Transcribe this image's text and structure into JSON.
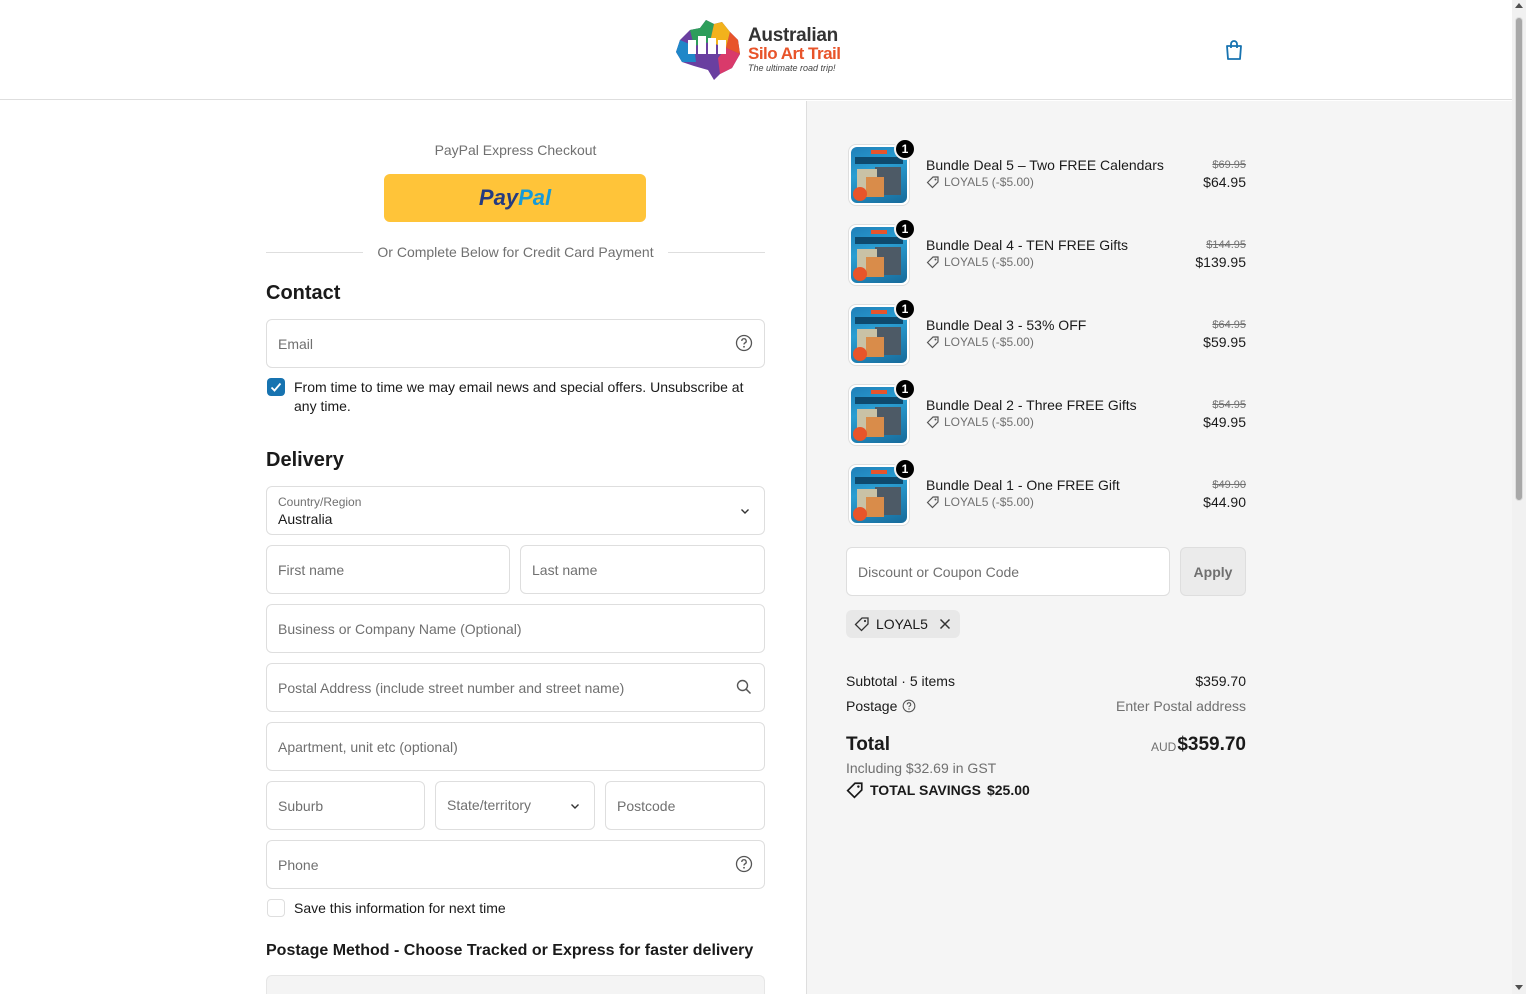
{
  "header": {
    "logo_line1": "Australian",
    "logo_line2": "Silo Art Trail",
    "logo_tagline": "The ultimate road trip!"
  },
  "express": {
    "title": "PayPal Express Checkout",
    "paypal_part1": "Pay",
    "paypal_part2": "Pal",
    "divider_text": "Or Complete Below for Credit Card Payment"
  },
  "contact": {
    "title": "Contact",
    "email_placeholder": "Email",
    "newsletter_text": "From time to time we may email news and special offers. Unsubscribe at any time.",
    "newsletter_checked": true
  },
  "delivery": {
    "title": "Delivery",
    "country_label": "Country/Region",
    "country_value": "Australia",
    "first_name_placeholder": "First name",
    "last_name_placeholder": "Last name",
    "company_placeholder": "Business or Company Name (Optional)",
    "address_placeholder": "Postal Address (include street number and street name)",
    "apartment_placeholder": "Apartment, unit etc (optional)",
    "suburb_placeholder": "Suburb",
    "state_placeholder": "State/territory",
    "postcode_placeholder": "Postcode",
    "phone_placeholder": "Phone",
    "save_info_text": "Save this information for next time",
    "save_info_checked": false
  },
  "postage": {
    "title": "Postage Method - Choose Tracked or Express for faster delivery"
  },
  "cart": {
    "items": [
      {
        "name": "Bundle Deal 5 – Two FREE Calendars",
        "discount": "LOYAL5 (-$5.00)",
        "old_price": "$69.95",
        "price": "$64.95",
        "qty": "1"
      },
      {
        "name": "Bundle Deal 4 - TEN FREE Gifts",
        "discount": "LOYAL5 (-$5.00)",
        "old_price": "$144.95",
        "price": "$139.95",
        "qty": "1"
      },
      {
        "name": "Bundle Deal 3 - 53% OFF",
        "discount": "LOYAL5 (-$5.00)",
        "old_price": "$64.95",
        "price": "$59.95",
        "qty": "1"
      },
      {
        "name": "Bundle Deal 2 - Three FREE Gifts",
        "discount": "LOYAL5 (-$5.00)",
        "old_price": "$54.95",
        "price": "$49.95",
        "qty": "1"
      },
      {
        "name": "Bundle Deal 1 - One FREE Gift",
        "discount": "LOYAL5 (-$5.00)",
        "old_price": "$49.90",
        "price": "$44.90",
        "qty": "1"
      }
    ],
    "coupon_placeholder": "Discount or Coupon Code",
    "apply_label": "Apply",
    "applied_code": "LOYAL5"
  },
  "summary": {
    "subtotal_label": "Subtotal · 5 items",
    "subtotal_value": "$359.70",
    "postage_label": "Postage",
    "postage_value": "Enter Postal address",
    "total_label": "Total",
    "currency": "AUD",
    "total_value": "$359.70",
    "gst_text": "Including $32.69 in GST",
    "savings_label": "TOTAL SAVINGS",
    "savings_value": "$25.00"
  },
  "colors": {
    "paypal_yellow": "#ffc439",
    "checkbox_blue": "#1773b0",
    "logo_orange": "#e8542a",
    "cart_blue": "#1773b0"
  },
  "icons": [
    "shopping-bag-icon",
    "help-circle-icon",
    "search-icon",
    "chevron-down-icon",
    "tag-icon",
    "close-icon",
    "checkmark-icon"
  ]
}
